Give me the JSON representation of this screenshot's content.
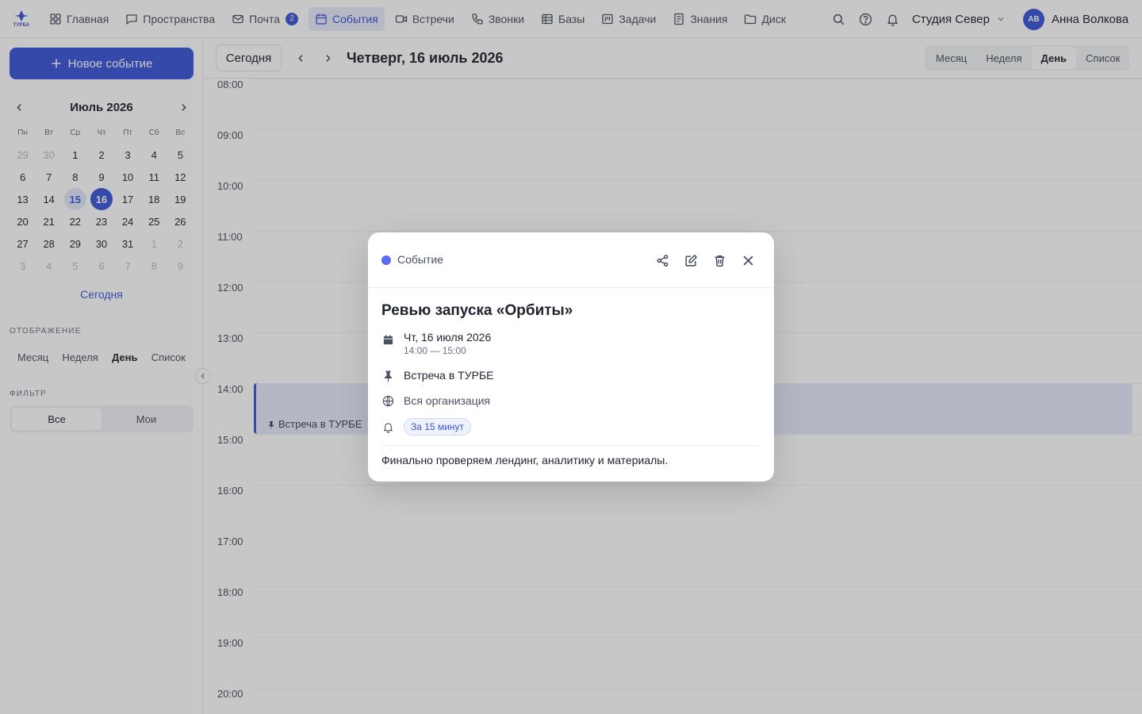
{
  "logo": {
    "text": "ТУРБА"
  },
  "nav": {
    "items": [
      {
        "label": "Главная",
        "icon": "grid-icon"
      },
      {
        "label": "Пространства",
        "icon": "chat-icon"
      },
      {
        "label": "Почта",
        "icon": "mail-icon",
        "badge": "2"
      },
      {
        "label": "События",
        "icon": "calendar-icon",
        "active": true
      },
      {
        "label": "Встречи",
        "icon": "video-icon"
      },
      {
        "label": "Звонки",
        "icon": "phone-icon"
      },
      {
        "label": "Базы",
        "icon": "table-icon"
      },
      {
        "label": "Задачи",
        "icon": "kanban-icon"
      },
      {
        "label": "Знания",
        "icon": "book-icon"
      },
      {
        "label": "Диск",
        "icon": "folder-icon"
      }
    ]
  },
  "header": {
    "workspace": "Студия Север",
    "user": {
      "initials": "АВ",
      "name": "Анна Волкова"
    }
  },
  "sidebar": {
    "new_event_label": "Новое событие",
    "mini_calendar": {
      "title": "Июль 2026",
      "weekdays": [
        "Пн",
        "Вт",
        "Ср",
        "Чт",
        "Пт",
        "Сб",
        "Вс"
      ],
      "weeks": [
        [
          "29",
          "30",
          "1",
          "2",
          "3",
          "4",
          "5"
        ],
        [
          "6",
          "7",
          "8",
          "9",
          "10",
          "11",
          "12"
        ],
        [
          "13",
          "14",
          "15",
          "16",
          "17",
          "18",
          "19"
        ],
        [
          "20",
          "21",
          "22",
          "23",
          "24",
          "25",
          "26"
        ],
        [
          "27",
          "28",
          "29",
          "30",
          "31",
          "1",
          "2"
        ],
        [
          "3",
          "4",
          "5",
          "6",
          "7",
          "8",
          "9"
        ]
      ],
      "today": "15",
      "selected": "16"
    },
    "today_link": "Сегодня",
    "display_label": "Отображение",
    "views": [
      "Месяц",
      "Неделя",
      "День",
      "Список"
    ],
    "active_view": "День",
    "filter_label": "Фильтр",
    "filters": [
      "Все",
      "Мои"
    ],
    "active_filter": "Все"
  },
  "toolbar": {
    "today_label": "Сегодня",
    "date_title": "Четверг, 16 июль 2026",
    "views": [
      "Месяц",
      "Неделя",
      "День",
      "Список"
    ],
    "active_view": "День"
  },
  "timeline": {
    "hours": [
      "08:00",
      "09:00",
      "10:00",
      "11:00",
      "12:00",
      "13:00",
      "14:00",
      "15:00",
      "16:00",
      "17:00",
      "18:00",
      "19:00",
      "20:00"
    ],
    "event_label": "Встреча в ТУРБЕ"
  },
  "modal": {
    "kind": "Событие",
    "accent_color": "#5a6cf0",
    "title": "Ревью запуска «Орбиты»",
    "date": "Чт, 16 июля 2026",
    "time": "14:00 — 15:00",
    "location": "Встреча в ТУРБЕ",
    "audience": "Вся организация",
    "reminder": "За 15 минут",
    "description": "Финально проверяем лендинг, аналитику и материалы."
  }
}
